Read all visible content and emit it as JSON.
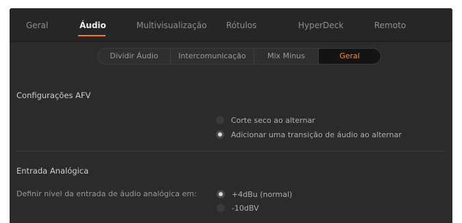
{
  "tabs": [
    "Geral",
    "Áudio",
    "Multivisualização",
    "Rótulos",
    "HyperDeck",
    "Remoto"
  ],
  "active_tab": "Áudio",
  "subtabs": [
    "Dividir Áudio",
    "Intercomunicação",
    "Mix Minus",
    "Geral"
  ],
  "active_subtab": "Geral",
  "afv": {
    "title": "Configurações AFV",
    "options": [
      "Corte seco ao alternar",
      "Adicionar uma transição de áudio ao alternar"
    ],
    "selected_index": 1
  },
  "analog": {
    "title": "Entrada Analógica",
    "level_label": "Definir nível da entrada de áudio analógica em:",
    "options": [
      "+4dBu (normal)",
      "-10dBV"
    ],
    "selected_index": 0
  },
  "colors": {
    "accent": "#ff7a1e",
    "panel_bg": "#2b2b2b",
    "topbar_bg": "#262626"
  }
}
